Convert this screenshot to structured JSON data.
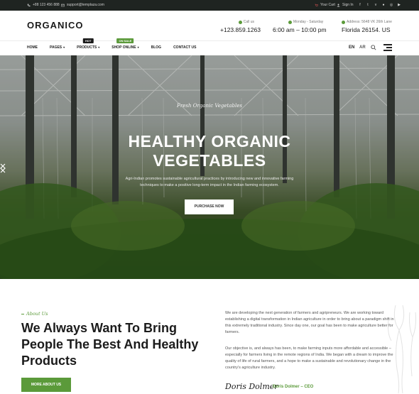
{
  "topbar": {
    "phone": "+88 123 456 888",
    "email": "support@templaza.com",
    "cart": "Your Cart",
    "signin": "Sign In",
    "social_icons": [
      "facebook-icon",
      "twitter-icon",
      "vimeo-icon",
      "github-icon",
      "instagram-icon",
      "youtube-icon"
    ]
  },
  "header": {
    "logo": "ORGANICO",
    "call_label": "Call us",
    "call_value": "+123.859.1263",
    "time_label": "Monday - Saturday",
    "time_value": "6:00 am – 10:00 pm",
    "address_label": "Address: 5648 VK 26th Lane",
    "address_value": "Florida 26154. US"
  },
  "nav": {
    "items": [
      {
        "label": "HOME"
      },
      {
        "label": "PAGES",
        "caret": "▾"
      },
      {
        "label": "PRODUCTS",
        "caret": "▾",
        "badge": "HOT"
      },
      {
        "label": "SHOP ONLINE",
        "caret": "▾",
        "badge": "ON SALE"
      },
      {
        "label": "BLOG"
      },
      {
        "label": "CONTACT US"
      }
    ],
    "lang_en": "EN",
    "lang_ar": "AR"
  },
  "hero": {
    "subtitle": "Fresh Organic Vegetables",
    "title_line1": "HEALTHY ORGANIC",
    "title_line2": "VEGETABLES",
    "description": "Agri-Indian promotes sustainable agricultural practices by introducing new and innovative farming techniques to make a positive long-term impact in the Indian farming ecosystem.",
    "button": "PURCHASE NOW"
  },
  "about": {
    "tag": "About Us",
    "title": "We Always Want To Bring People The Best And Healthy Products",
    "button": "MORE ABOUT US",
    "paragraph1": "We are developing the next generation of farmers and agripreneurs. We are working toward establishing a digital transformation in Indian agriculture in order to bring about a paradigm shift in this extremely traditional industry. Since day one, our goal has been to make agriculture better for farmers.",
    "paragraph2": "Our objective is, and always has been, to make farming inputs more affordable and accessible – especially for farmers living in the remote regions of India. We began with a dream to improve the quality of life of rural farmers, and a hope to make a sustainable and revolutionary change in the country's agriculture industry.",
    "signature": "Doris Dolmer",
    "signer": "Doris Dolmer – CEO"
  },
  "colors": {
    "accent": "#5b9a3a",
    "topbar": "#1f2421"
  }
}
